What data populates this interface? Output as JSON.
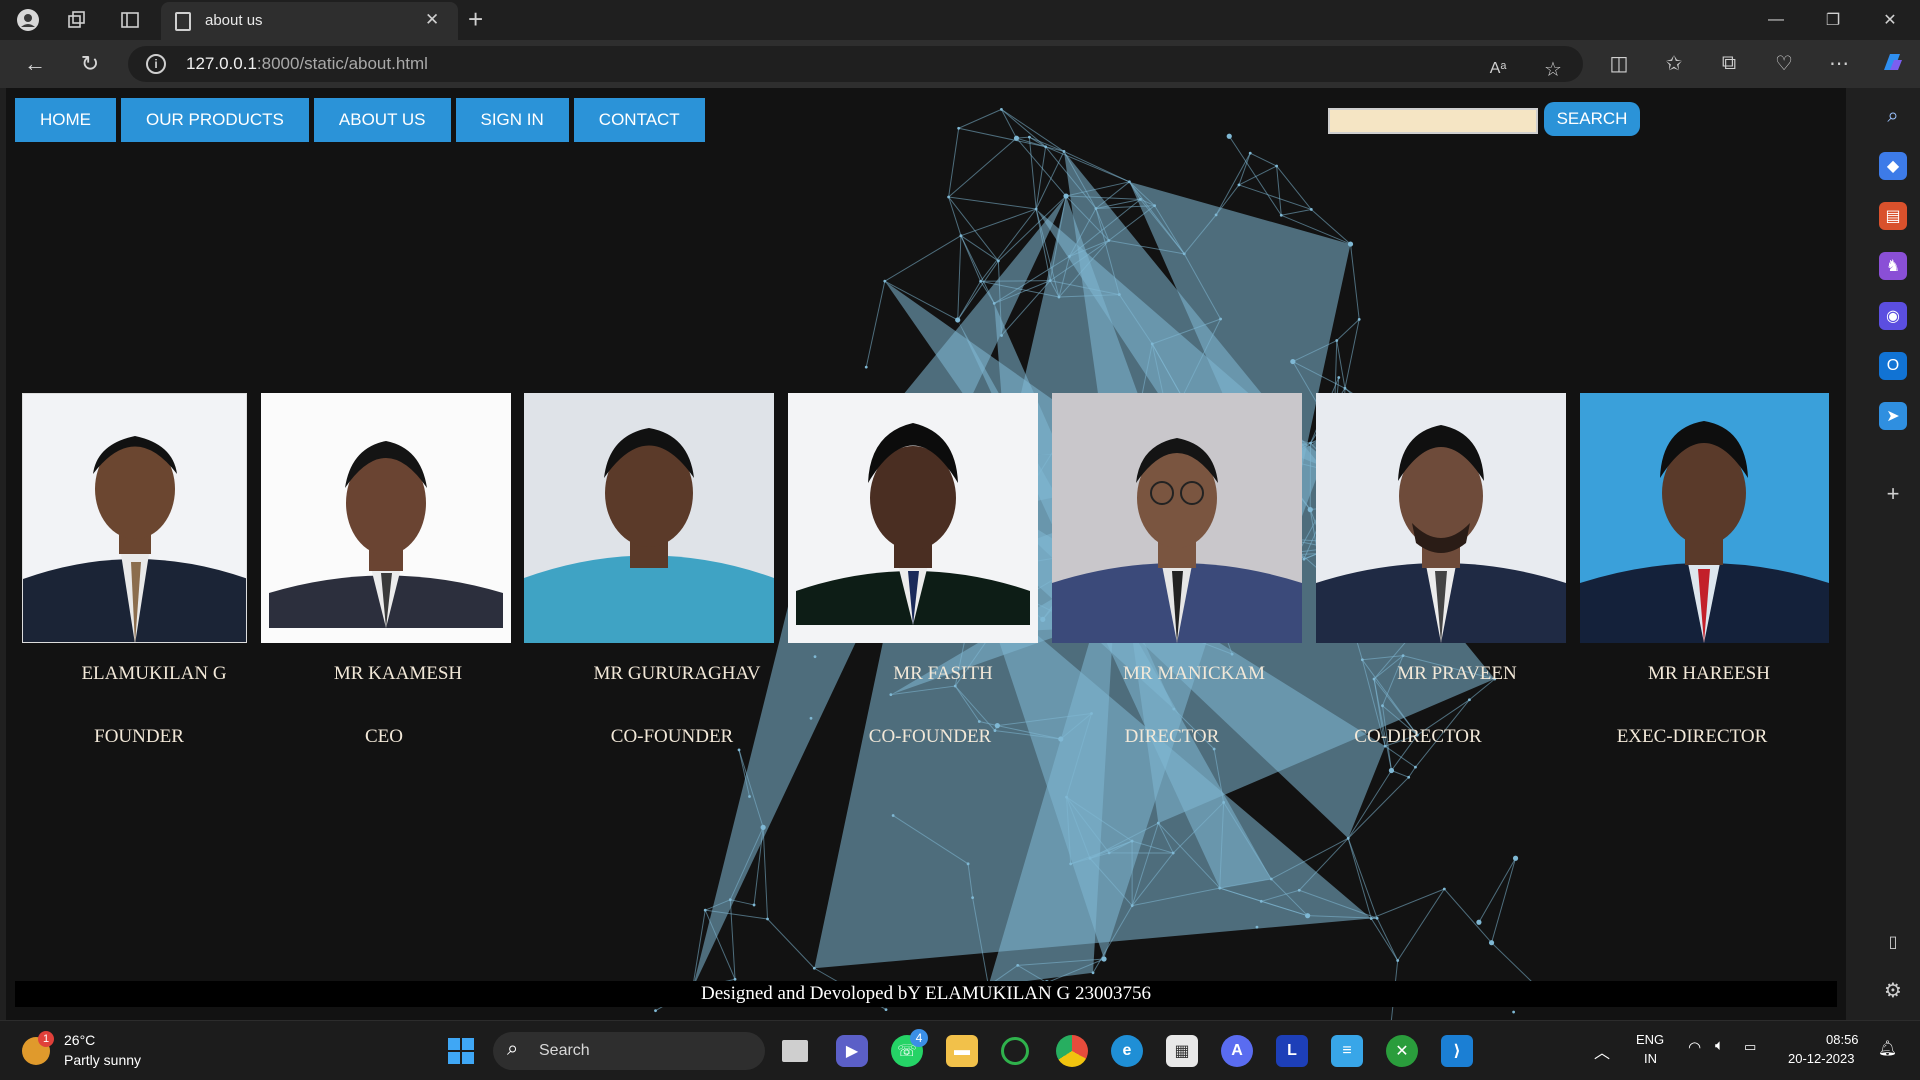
{
  "browser": {
    "tab_title": "about us",
    "url_host": "127.0.0.1",
    "url_path": ":8000/static/about.html"
  },
  "page": {
    "nav": [
      {
        "label": "HOME"
      },
      {
        "label": "OUR PRODUCTS"
      },
      {
        "label": "ABOUT US"
      },
      {
        "label": "SIGN IN"
      },
      {
        "label": "CONTACT"
      }
    ],
    "search": {
      "value": "",
      "button_label": "SEARCH"
    },
    "team": [
      {
        "name": "ELAMUKILAN G",
        "role": "FOUNDER"
      },
      {
        "name": "MR KAAMESH",
        "role": "CEO"
      },
      {
        "name": "MR GURURAGHAV",
        "role": "CO-FOUNDER"
      },
      {
        "name": "MR FASITH",
        "role": "CO-FOUNDER"
      },
      {
        "name": "MR MANICKAM",
        "role": "DIRECTOR"
      },
      {
        "name": "MR PRAVEEN",
        "role": "CO-DIRECTOR"
      },
      {
        "name": "MR HAREESH",
        "role": "EXEC-DIRECTOR"
      }
    ],
    "footer": "Designed and Devoloped bY ELAMUKILAN G 23003756"
  },
  "taskbar": {
    "weather_temp": "26°C",
    "weather_desc": "Partly sunny",
    "weather_badge": "1",
    "search_label": "Search",
    "whatsapp_badge": "4",
    "lang_top": "ENG",
    "lang_bottom": "IN",
    "time": "08:56",
    "date": "20-12-2023"
  },
  "colors": {
    "nav_button": "#2b93d8",
    "page_bg": "#121212",
    "network_lines": "#7fb8d4",
    "caption_text": "#f2e8d8"
  }
}
